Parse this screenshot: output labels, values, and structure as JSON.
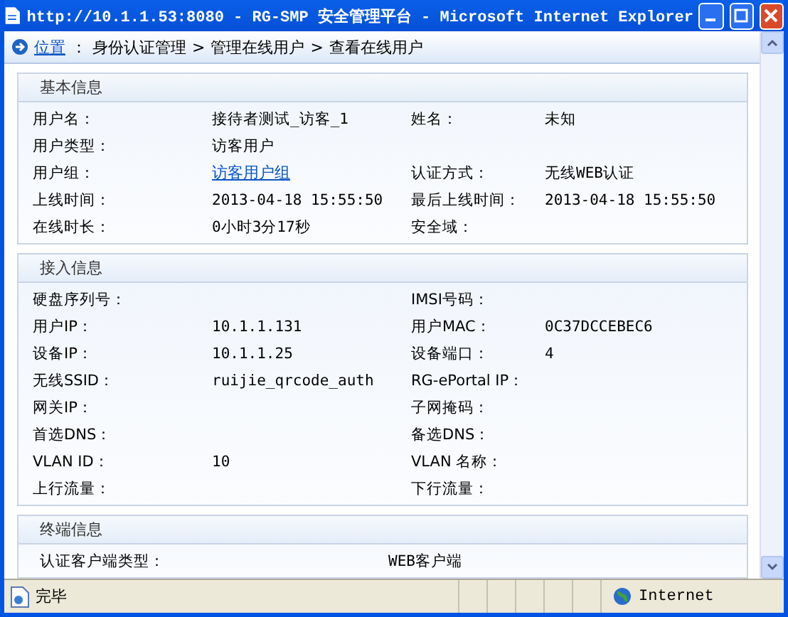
{
  "window": {
    "title": "http://10.1.1.53:8080 - RG-SMP 安全管理平台 - Microsoft Internet Explorer"
  },
  "breadcrumb": {
    "location": "位置",
    "separator": "：",
    "items": [
      {
        "label": "身份认证管理"
      },
      {
        "label": "管理在线用户"
      },
      {
        "label": "查看在线用户"
      }
    ],
    "arrow": ">"
  },
  "sections": [
    {
      "title": "基本信息",
      "kind": "pairs",
      "rows": [
        {
          "fields": [
            {
              "label": "用户名：",
              "value": "接待者测试_访客_1"
            },
            {
              "label": "姓名：",
              "value": "未知"
            }
          ]
        },
        {
          "fields": [
            {
              "label": "用户类型：",
              "value": "访客用户"
            }
          ]
        },
        {
          "fields": [
            {
              "label": "用户组：",
              "value": "访客用户组",
              "kind": "link"
            },
            {
              "label": "认证方式：",
              "value": "无线WEB认证"
            }
          ]
        },
        {
          "fields": [
            {
              "label": "上线时间：",
              "value": "2013-04-18 15:55:50"
            },
            {
              "label": "最后上线时间：",
              "value": "2013-04-18 15:55:50"
            }
          ]
        },
        {
          "fields": [
            {
              "label": "在线时长：",
              "value": "0小时3分17秒"
            },
            {
              "label": "安全域："
            }
          ]
        }
      ]
    },
    {
      "title": "接入信息",
      "kind": "pairs",
      "rows": [
        {
          "fields": [
            {
              "label": "硬盘序列号："
            },
            {
              "label": "IMSI号码："
            }
          ]
        },
        {
          "fields": [
            {
              "label": "用户IP：",
              "value": "10.1.1.131"
            },
            {
              "label": "用户MAC：",
              "value": "0C37DCCEBEC6"
            }
          ]
        },
        {
          "fields": [
            {
              "label": "设备IP：",
              "value": "10.1.1.25"
            },
            {
              "label": "设备端口：",
              "value": "4"
            }
          ]
        },
        {
          "fields": [
            {
              "label": "无线SSID：",
              "value": "ruijie_qrcode_auth"
            },
            {
              "label": "RG-ePortal IP："
            }
          ]
        },
        {
          "fields": [
            {
              "label": "网关IP："
            },
            {
              "label": "子网掩码："
            }
          ]
        },
        {
          "fields": [
            {
              "label": "首选DNS："
            },
            {
              "label": "备选DNS："
            }
          ]
        },
        {
          "fields": [
            {
              "label": "VLAN ID：",
              "value": "10"
            },
            {
              "label": "VLAN 名称："
            }
          ]
        },
        {
          "fields": [
            {
              "label": "上行流量："
            },
            {
              "label": "下行流量："
            }
          ]
        }
      ]
    },
    {
      "title": "终端信息",
      "kind": "single",
      "rows": [
        {
          "fields": [
            {
              "label": "认证客户端类型：",
              "value": "WEB客户端"
            }
          ]
        }
      ]
    }
  ],
  "status_bar": {
    "text": "完毕",
    "zone": "Internet"
  }
}
